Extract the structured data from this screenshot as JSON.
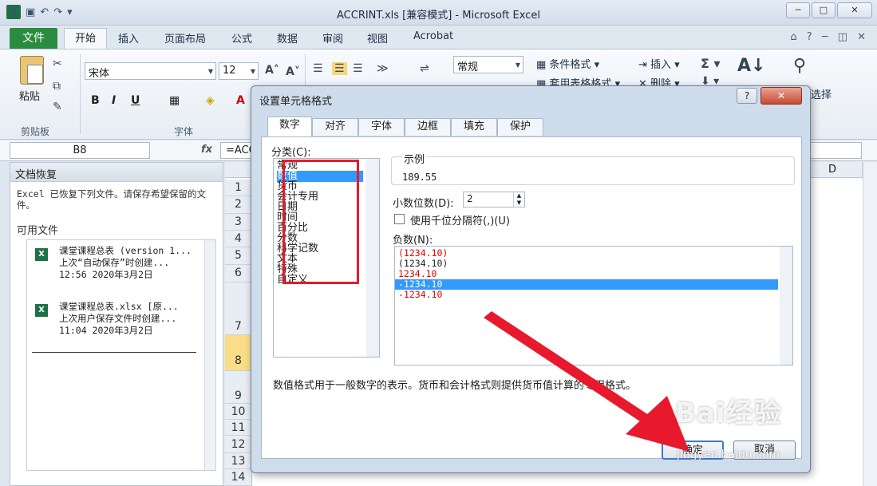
{
  "window": {
    "title": "ACCRINT.xls  [兼容模式] - Microsoft Excel"
  },
  "ribbon_tabs": {
    "file": "文件",
    "items": [
      "开始",
      "插入",
      "页面布局",
      "公式",
      "数据",
      "审阅",
      "视图",
      "Acrobat"
    ]
  },
  "ribbon": {
    "paste": "粘贴",
    "clipboard_group": "剪贴板",
    "font_group": "字体",
    "font_name": "宋体",
    "font_size": "12",
    "number_format": "常规",
    "cond_format": "条件格式",
    "table_format": "套用表格格式",
    "insert": "插入",
    "delete": "删除",
    "select": "选择"
  },
  "formula_bar": {
    "name_box": "B8",
    "formula": "=ACC"
  },
  "recovery": {
    "header": "文档恢复",
    "description": "Excel 已恢复下列文件。请保存希望保留的文件。",
    "available": "可用文件",
    "files": [
      {
        "name": "课堂课程总表 (version 1...",
        "line2": "上次“自动保存”时创建...",
        "time": "12:56 2020年3月2日"
      },
      {
        "name": "课堂课程总表.xlsx  [原...",
        "line2": "上次用户保存文件时创建...",
        "time": "11:04 2020年3月2日"
      }
    ]
  },
  "sheet": {
    "rows": [
      "1",
      "2",
      "3",
      "4",
      "5",
      "6",
      "7",
      "8",
      "9",
      "10",
      "11",
      "12",
      "13",
      "14"
    ],
    "col_d": "D"
  },
  "dialog": {
    "title": "设置单元格格式",
    "tabs": [
      "数字",
      "对齐",
      "字体",
      "边框",
      "填充",
      "保护"
    ],
    "category_label": "分类(C):",
    "categories": [
      "常规",
      "数值",
      "货币",
      "会计专用",
      "日期",
      "时间",
      "百分比",
      "分数",
      "科学记数",
      "文本",
      "特殊",
      "自定义"
    ],
    "selected_category": "数值",
    "sample_label": "示例",
    "sample_value": "189.55",
    "decimal_label": "小数位数(D):",
    "decimal_value": "2",
    "thousands_label": "使用千位分隔符(,)(U)",
    "negative_label": "负数(N):",
    "negatives": [
      "(1234.10)",
      "(1234.10)",
      "1234.10",
      "-1234.10",
      "-1234.10"
    ],
    "description": "数值格式用于一般数字的表示。货币和会计格式则提供货币值计算的专用格式。",
    "ok": "确定",
    "cancel": "取消"
  },
  "watermark": {
    "brand": "Bai经验",
    "url": "jingyan.baidu.com"
  },
  "colors": {
    "accent_red": "#e8192c",
    "selection_blue": "#3399ff",
    "file_tab_green": "#2a8c3f"
  }
}
